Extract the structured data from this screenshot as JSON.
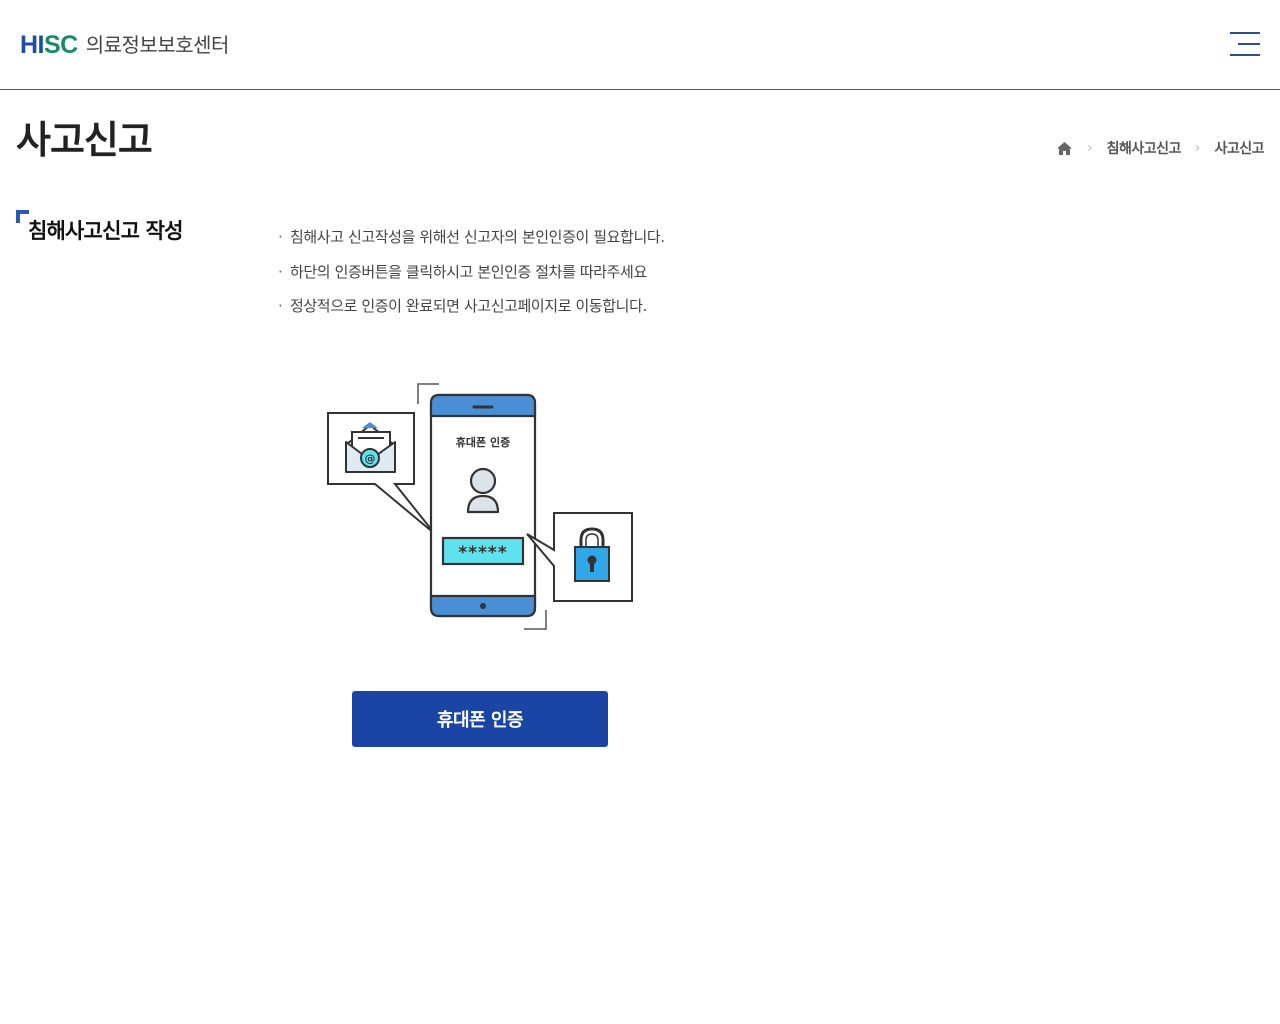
{
  "header": {
    "logo_mark_hi": "HI",
    "logo_mark_sc": "SC",
    "logo_text": "의료정보보호센터"
  },
  "page": {
    "title": "사고신고"
  },
  "breadcrumb": {
    "items": [
      "침해사고신고",
      "사고신고"
    ]
  },
  "section": {
    "title": "침해사고신고 작성",
    "notices": [
      "침해사고 신고작성을 위해선 신고자의 본인인증이 필요합니다.",
      "하단의 인증버튼을 클릭하시고 본인인증 절차를 따라주세요",
      "정상적으로 인증이 완료되면 사고신고페이지로 이동합니다."
    ]
  },
  "illustration": {
    "phone_label": "휴대폰 인증",
    "password_mask": "*****",
    "email_symbol": "@"
  },
  "auth_button": {
    "label": "휴대폰 인증"
  },
  "colors": {
    "brand_blue": "#1b45a5",
    "logo_green": "#1a8a6a",
    "accent_blue": "#2a5bb4",
    "phone_blue": "#4a8fd6",
    "password_cyan": "#5ee3ee",
    "lock_blue": "#2fa7e8"
  }
}
